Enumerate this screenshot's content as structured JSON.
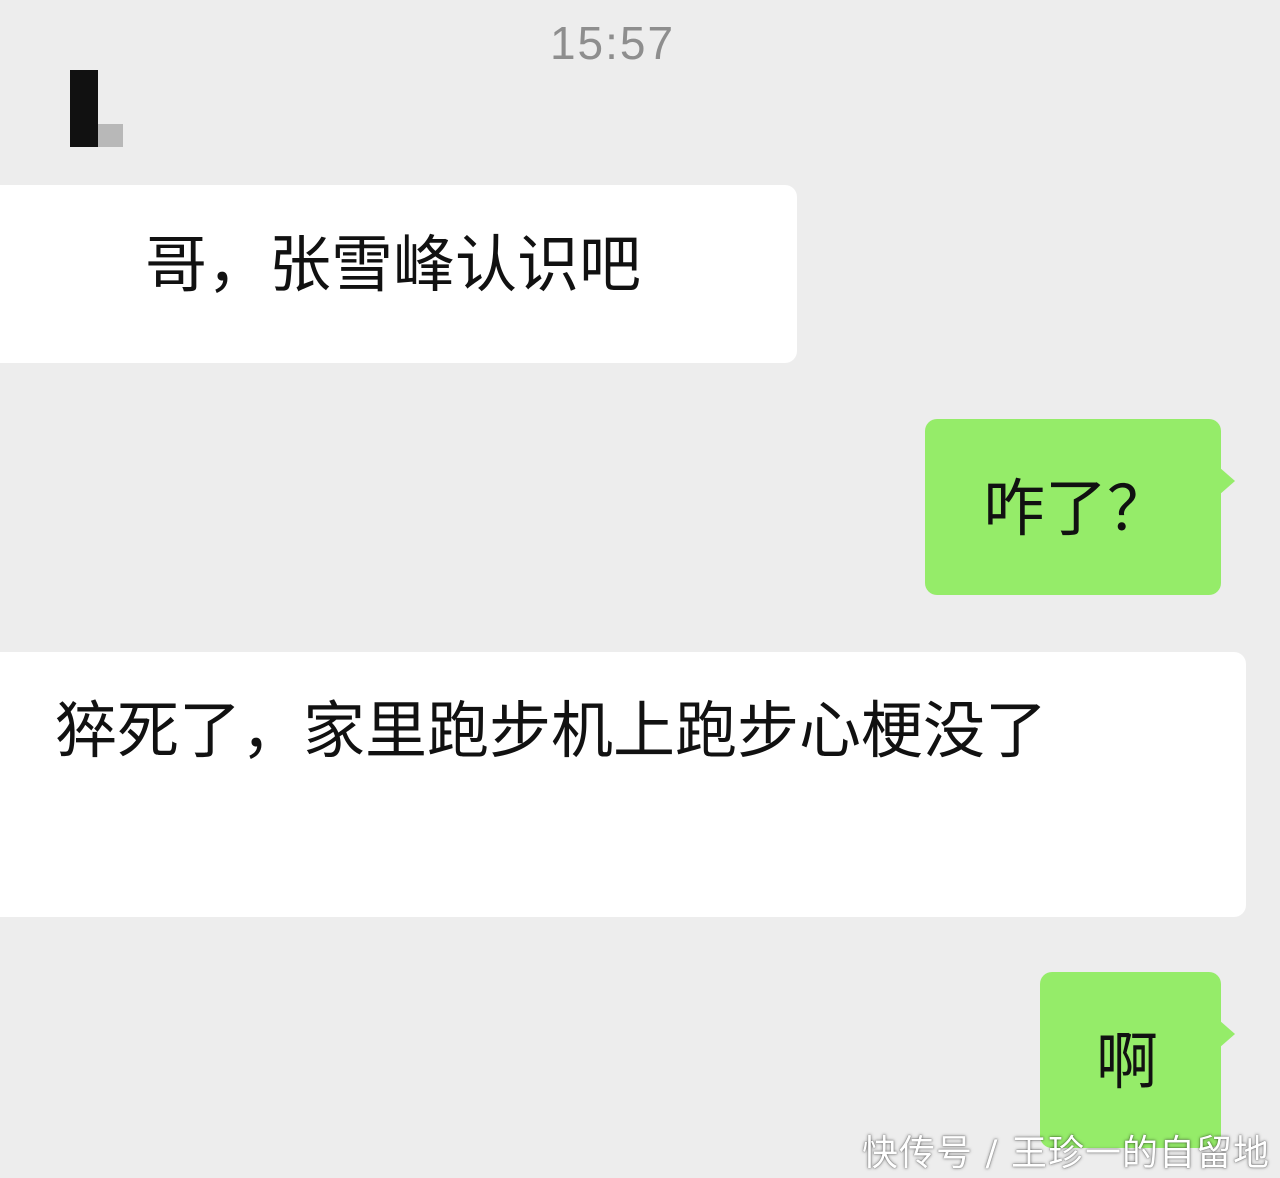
{
  "chat": {
    "timestamp": "15:57",
    "messages": [
      {
        "direction": "incoming",
        "text": "哥，张雪峰认识吧"
      },
      {
        "direction": "outgoing",
        "text": "咋了？"
      },
      {
        "direction": "incoming",
        "text": "猝死了，家里跑步机上跑步心梗没了"
      },
      {
        "direction": "outgoing",
        "text": "啊"
      }
    ]
  },
  "watermark": "快传号 / 王珍一的自留地",
  "colors": {
    "background": "#ededed",
    "incoming_bubble": "#ffffff",
    "outgoing_bubble": "#95ec69"
  }
}
